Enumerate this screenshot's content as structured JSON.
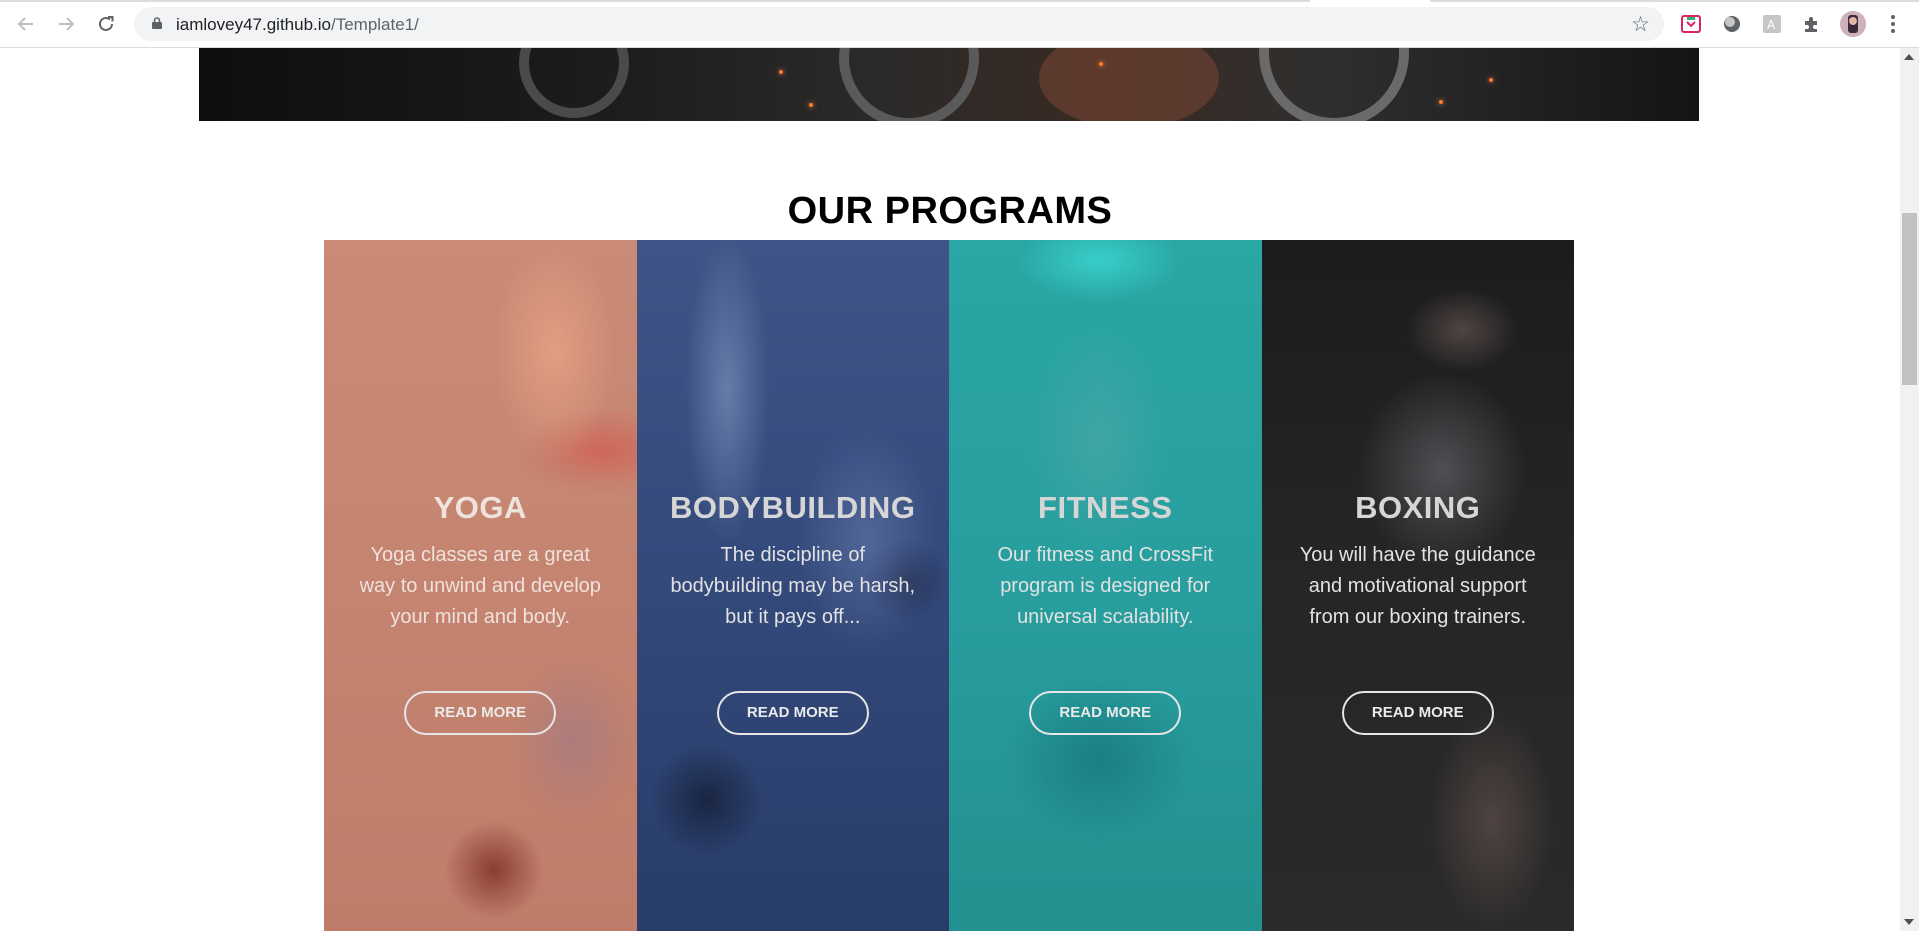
{
  "browser": {
    "url_host": "iamlovey47.github.io",
    "url_path": "/Template1/",
    "back_icon": "arrow-left",
    "forward_icon": "arrow-right",
    "reload_icon": "reload",
    "star_icon": "star",
    "extensions": [
      "pocket-icon",
      "circle-icon",
      "translate-icon",
      "puzzle-icon"
    ],
    "menu_icon": "kebab"
  },
  "section": {
    "title": "OUR PROGRAMS"
  },
  "programs": [
    {
      "title": "YOGA",
      "description": "Yoga classes are a great way to unwind and develop your mind and body.",
      "button": "READ MORE",
      "color": "#c98a76"
    },
    {
      "title": "BODYBUILDING",
      "description": "The discipline of bodybuilding may be harsh, but it pays off...",
      "button": "READ MORE",
      "color": "#33497a"
    },
    {
      "title": "FITNESS",
      "description": "Our fitness and CrossFit program is designed for universal scalability.",
      "button": "READ MORE",
      "color": "#289e9e"
    },
    {
      "title": "BOXING",
      "description": "You will have the guidance and motivational support from our boxing trainers.",
      "button": "READ MORE",
      "color": "#262626"
    }
  ]
}
